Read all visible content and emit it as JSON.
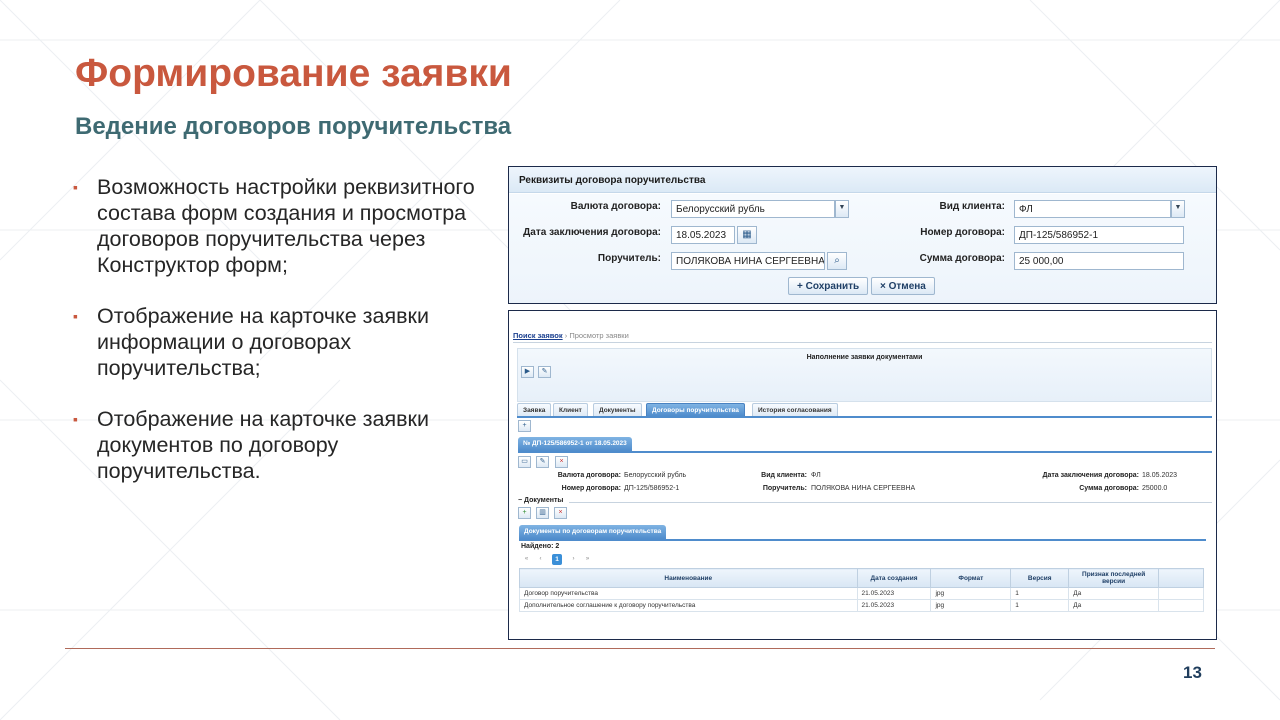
{
  "slide": {
    "title": "Формирование заявки",
    "subtitle": "Ведение договоров поручительства",
    "bullets": [
      "Возможность настройки реквизитного состава форм создания и просмотра договоров поручительства через Конструктор форм;",
      "Отображение на карточке заявки информации о договорах поручительства;",
      "Отображение на карточке заявки документов по договору поручительства."
    ],
    "page_number": "13",
    "colors": {
      "title": "#c9583e",
      "subtitle": "#3e6a72",
      "accent": "#4f8ccc"
    }
  },
  "form": {
    "header": "Реквизиты договора поручительства",
    "currency_label": "Валюта договора:",
    "currency_value": "Белорусский рубль",
    "client_type_label": "Вид клиента:",
    "client_type_value": "ФЛ",
    "date_label": "Дата заключения договора:",
    "date_value": "18.05.2023",
    "number_label": "Номер договора:",
    "number_value": "ДП-125/586952-1",
    "guarantor_label": "Поручитель:",
    "guarantor_value": "ПОЛЯКОВА НИНА СЕРГЕЕВНА",
    "sum_label": "Сумма договора:",
    "sum_value": "25 000,00",
    "save_label": "Сохранить",
    "cancel_label": "Отмена"
  },
  "card": {
    "breadcrumb_link": "Поиск заявок",
    "breadcrumb_sep": "›",
    "breadcrumb_current": "Просмотр заявки",
    "section_title": "Наполнение заявки документами",
    "tabs": [
      "Заявка",
      "Клиент",
      "Документы",
      "Договоры поручительства",
      "История согласования"
    ],
    "active_tab": 3,
    "contract_header": "№ ДП-125/586952-1 от 18.05.2023",
    "info": {
      "currency_label": "Валюта договора:",
      "currency_value": "Белорусский рубль",
      "client_type_label": "Вид клиента:",
      "client_type_value": "ФЛ",
      "date_label": "Дата заключения договора:",
      "date_value": "18.05.2023",
      "number_label": "Номер договора:",
      "number_value": "ДП-125/586952-1",
      "guarantor_label": "Поручитель:",
      "guarantor_value": "ПОЛЯКОВА НИНА СЕРГЕЕВНА",
      "sum_label": "Сумма договора:",
      "sum_value": "25000.0"
    },
    "docs_toggle": "− Документы",
    "docs_header": "Документы по договорам поручительства",
    "found_label": "Найдено: 2",
    "current_page": "1",
    "columns": [
      "Наименование",
      "Дата создания",
      "Формат",
      "Версия",
      "Признак последней версии"
    ],
    "rows": [
      [
        "Договор поручительства",
        "21.05.2023",
        "jpg",
        "1",
        "Да"
      ],
      [
        "Дополнительное соглашение к договору поручительства",
        "21.05.2023",
        "jpg",
        "1",
        "Да"
      ]
    ]
  }
}
